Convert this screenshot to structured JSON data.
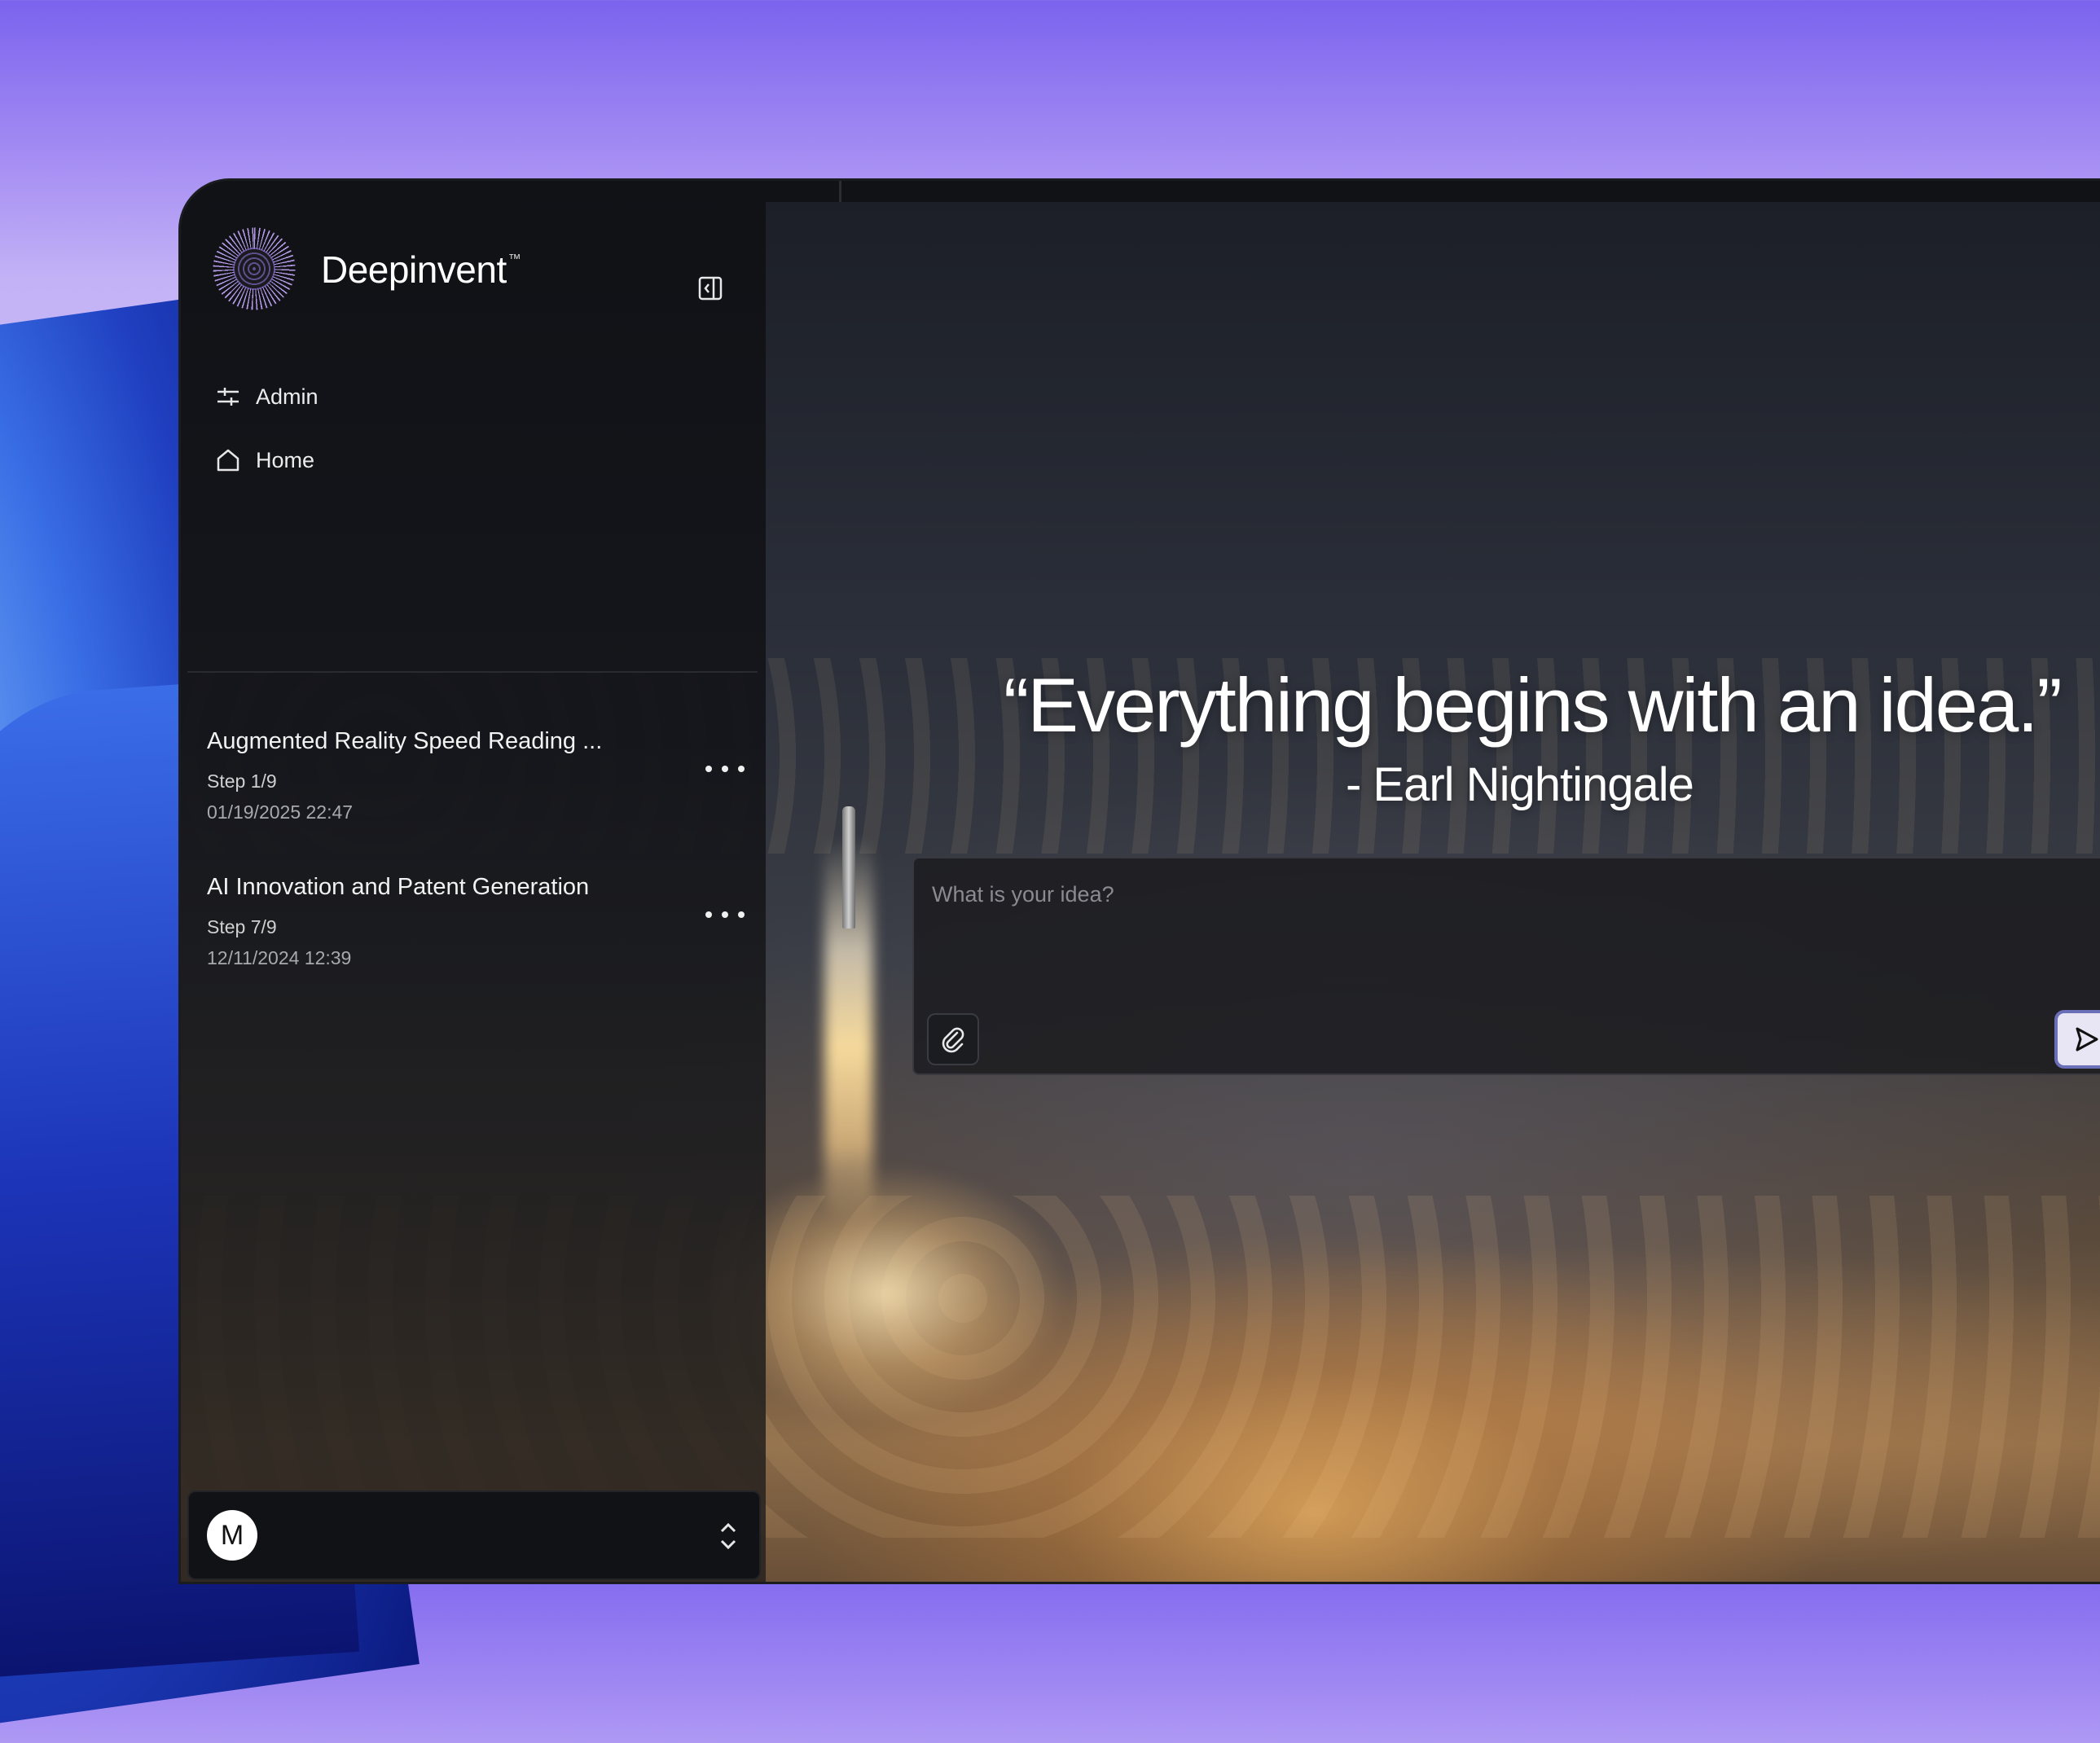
{
  "app": {
    "brand_name": "Deepinvent",
    "brand_mark": "™",
    "accent_color": "#7b63ee"
  },
  "sidebar": {
    "nav": [
      {
        "label": "Admin",
        "icon": "sliders-icon"
      },
      {
        "label": "Home",
        "icon": "home-icon"
      }
    ],
    "chats": [
      {
        "title": "Augmented Reality Speed Reading ...",
        "step": "Step 1/9",
        "date": "01/19/2025 22:47"
      },
      {
        "title": "AI Innovation and Patent Generation",
        "step": "Step 7/9",
        "date": "12/11/2024 12:39"
      }
    ],
    "user": {
      "initial": "M"
    }
  },
  "main": {
    "quote": "“Everything begins with an idea.”",
    "author": "- Earl Nightingale",
    "input": {
      "placeholder": "What is your idea?",
      "value": ""
    }
  }
}
